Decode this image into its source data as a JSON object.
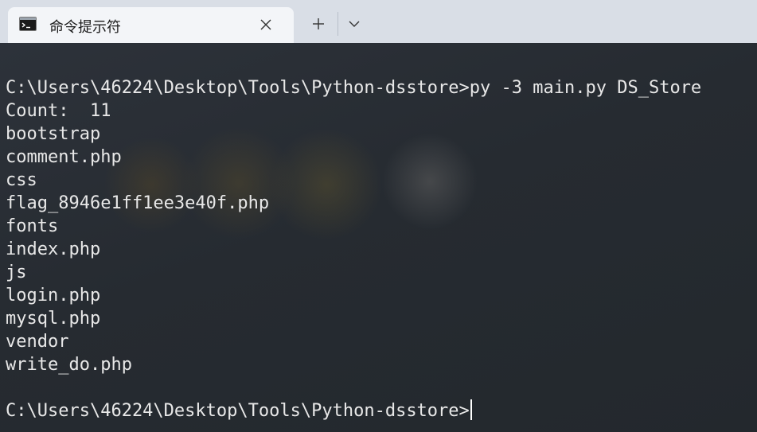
{
  "tab": {
    "title": "命令提示符",
    "icon": "terminal-icon",
    "close_icon": "close-icon"
  },
  "toolbar": {
    "new_tab_icon": "plus-icon",
    "dropdown_icon": "chevron-down-icon"
  },
  "terminal": {
    "command_line": "C:\\Users\\46224\\Desktop\\Tools\\Python-dsstore>py -3 main.py DS_Store",
    "output": [
      "Count:  11",
      "bootstrap",
      "comment.php",
      "css",
      "flag_8946e1ff1ee3e40f.php",
      "fonts",
      "index.php",
      "js",
      "login.php",
      "mysql.php",
      "vendor",
      "write_do.php"
    ],
    "prompt": "C:\\Users\\46224\\Desktop\\Tools\\Python-dsstore>"
  },
  "colors": {
    "titlebar": "#d9dee6",
    "tab": "#f3f5f8",
    "terminal_bg": "#2b2f35",
    "terminal_text": "#e8e8e8"
  }
}
